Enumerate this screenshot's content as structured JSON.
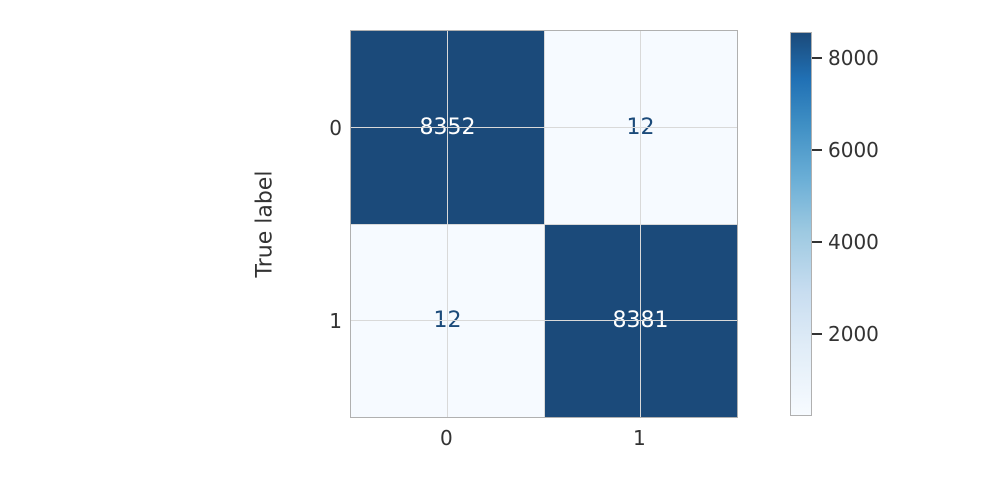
{
  "chart_data": {
    "type": "heatmap",
    "ylabel": "True label",
    "xlabel": "",
    "title": "",
    "x_categories": [
      "0",
      "1"
    ],
    "y_categories": [
      "0",
      "1"
    ],
    "matrix": [
      [
        8352,
        12
      ],
      [
        12,
        8381
      ]
    ],
    "cell_labels": [
      [
        "8352",
        "12"
      ],
      [
        "12",
        "8381"
      ]
    ],
    "colorbar": {
      "ticks": [
        2000,
        4000,
        6000,
        8000
      ],
      "vmin": 12,
      "vmax": 8381
    },
    "colors": {
      "high": "#1b4a7a",
      "low": "#f6faff"
    }
  }
}
